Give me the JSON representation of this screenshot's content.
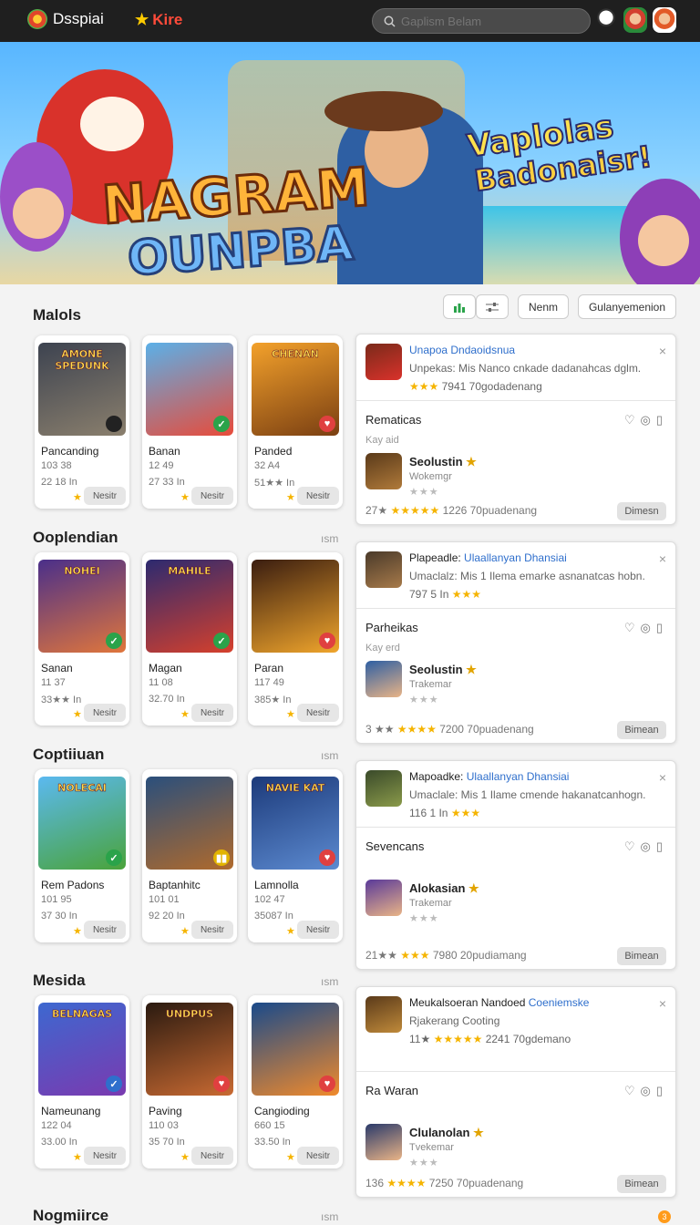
{
  "header": {
    "app_name": "Dsspiai",
    "store_label": "Kire",
    "search_placeholder": "Gaplism Belam"
  },
  "hero": {
    "title_line1": "NAGRAM",
    "title_line2": "OUNPBA",
    "badge_line1": "Vaplolas",
    "badge_line2": "Badonaisr!"
  },
  "toolbar": {
    "filter1_icon": "chart-icon",
    "filter2_icon": "sliders-icon",
    "menu_label": "Nenm",
    "category_label": "Gulanyemenion"
  },
  "sections": [
    {
      "title": "Malols",
      "more": "",
      "cards": [
        {
          "thumb_text": "AMONE SPEDUNK",
          "name": "Pancanding",
          "m1": "103 38",
          "m2": "22 18  In",
          "btn": "Nesitr",
          "tag": "",
          "tag_color": "#222"
        },
        {
          "thumb_text": "",
          "name": "Banan",
          "m1": "12 49",
          "m2": "27 33  In",
          "btn": "Nesitr",
          "tag": "✓",
          "tag_color": "#2aa34a"
        },
        {
          "thumb_text": "CHENAN",
          "name": "Panded",
          "m1": "32 A4",
          "m2": "51★★  In",
          "btn": "Nesitr",
          "tag": "♥",
          "tag_color": "#e04040"
        }
      ]
    },
    {
      "title": "Ooplendian",
      "more": "ısm",
      "cards": [
        {
          "thumb_text": "NOHEI",
          "name": "Sanan",
          "m1": "11 37",
          "m2": "33★★  In",
          "btn": "Nesitr",
          "tag": "✓",
          "tag_color": "#2aa34a"
        },
        {
          "thumb_text": "MAHILE",
          "name": "Magan",
          "m1": "11 08",
          "m2": "32.70  In",
          "btn": "Nesitr",
          "tag": "✓",
          "tag_color": "#2aa34a"
        },
        {
          "thumb_text": "",
          "name": "Paran",
          "m1": "117 49",
          "m2": "385★  In",
          "btn": "Nesitr",
          "tag": "♥",
          "tag_color": "#e04040"
        }
      ]
    },
    {
      "title": "Coptiiuan",
      "more": "ısm",
      "cards": [
        {
          "thumb_text": "NOLECAI",
          "name": "Rem Padons",
          "m1": "101 95",
          "m2": "37 30  In",
          "btn": "Nesitr",
          "tag": "✓",
          "tag_color": "#2aa34a"
        },
        {
          "thumb_text": "",
          "name": "Baptanhitc",
          "m1": "101 01",
          "m2": "92 20  In",
          "btn": "Nesitr",
          "tag": "▮▮",
          "tag_color": "#e2b400"
        },
        {
          "thumb_text": "NAVIE KAT",
          "name": "Lamnolla",
          "m1": "102 47",
          "m2": "35087  In",
          "btn": "Nesitr",
          "tag": "♥",
          "tag_color": "#e04040"
        }
      ]
    },
    {
      "title": "Mesida",
      "more": "ısm",
      "cards": [
        {
          "thumb_text": "BELNAGAS",
          "name": "Nameunang",
          "m1": "122 04",
          "m2": "33.00  In",
          "btn": "Nesitr",
          "tag": "✓",
          "tag_color": "#2f6fcc"
        },
        {
          "thumb_text": "UNDPUS",
          "name": "Paving",
          "m1": "110 03",
          "m2": "35 70  In",
          "btn": "Nesitr",
          "tag": "♥",
          "tag_color": "#e04040"
        },
        {
          "thumb_text": "",
          "name": "Cangioding",
          "m1": "660 15",
          "m2": "33.50  In",
          "btn": "Nesitr",
          "tag": "♥",
          "tag_color": "#e04040"
        }
      ]
    },
    {
      "title": "Nogmiirce",
      "more": "ısm",
      "cards": []
    }
  ],
  "panels": [
    {
      "title_prefix": "",
      "title_blue": "Unapoa Dndaoidsnua",
      "desc": "Unpekas: Mis Nanco cnkade dadanahcas dglm.",
      "meta_num": "",
      "meta_stars": "★★★",
      "meta_tail": "7941 70godadenang",
      "sub_title": "Rematicas",
      "sub_small": "Kay aid",
      "sub_name": "Seolustin",
      "sub_line": "Wokemgr",
      "row_meta_num": "27★",
      "row_meta_stars": "★★★★★",
      "row_meta_tail": "1226 70puadenang",
      "button": "Dimesn"
    },
    {
      "title_prefix": "Plapeadle: ",
      "title_blue": "Ulaallanyan Dhansiai",
      "desc": "Umaclalz: Mis 1 Ilema emarke asnanatcas hobn.",
      "meta_num": "797 5 In",
      "meta_stars": "★★★",
      "meta_tail": "",
      "sub_title": "Parheikas",
      "sub_small": "Kay erd",
      "sub_name": "Seolustin",
      "sub_line": "Trakemar",
      "row_meta_num": "3 ★★",
      "row_meta_stars": "★★★★",
      "row_meta_tail": "7200 70puadenang",
      "button": "Bimean"
    },
    {
      "title_prefix": "Mapoadke: ",
      "title_blue": "Ulaallanyan Dhansiai",
      "desc": "Umaclale: Mis 1 Ilame cmende hakanatcanhogn.",
      "meta_num": "116 1 In",
      "meta_stars": "★★★",
      "meta_tail": "",
      "sub_title": "Sevencans",
      "sub_small": "",
      "sub_name": "Alokasian",
      "sub_line": "Trakemar",
      "row_meta_num": "21★★",
      "row_meta_stars": "★★★",
      "row_meta_tail": "7980 20pudiamang",
      "button": "Bimean"
    },
    {
      "title_prefix": "Meukalsoeran Nandoed ",
      "title_blue": "Coeniemske",
      "desc": "Rjakerang Cooting",
      "meta_num": "11★",
      "meta_stars": "★★★★★",
      "meta_tail": "2241 70gdemano",
      "sub_title": "Ra Waran",
      "sub_small": "",
      "sub_name": "Clulanolan",
      "sub_line": "Tvekemar",
      "row_meta_num": "136",
      "row_meta_stars": "★★★★",
      "row_meta_tail": "7250 70puadenang",
      "button": "Bimean"
    }
  ],
  "colors": {
    "accent_red": "#ff4b3a",
    "link_blue": "#2f6fcc",
    "star_gold": "#f5b400"
  }
}
